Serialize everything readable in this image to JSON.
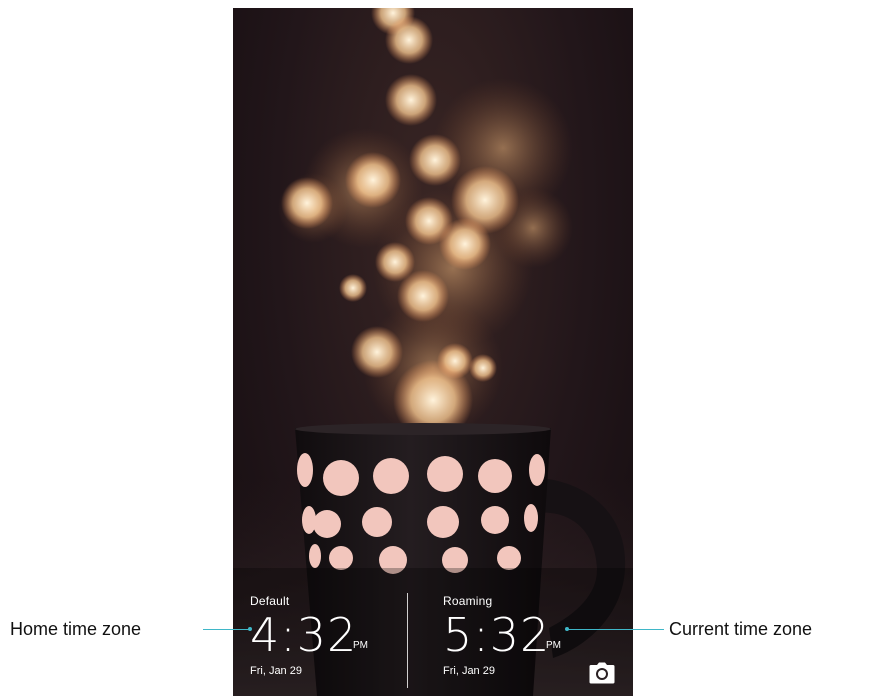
{
  "lockscreen": {
    "home": {
      "label": "Default",
      "time": "4:32",
      "ampm": "PM",
      "date": "Fri, Jan 29"
    },
    "current": {
      "label": "Roaming",
      "time": "5:32",
      "ampm": "PM",
      "date": "Fri, Jan 29"
    },
    "camera_icon": "camera-icon"
  },
  "callouts": {
    "home": "Home time zone",
    "current": "Current time zone"
  },
  "colors": {
    "callout_line": "#3fb7c8",
    "mug": "#1a1518",
    "dots": "#f2c6bd",
    "bokeh": "#ffd9a8"
  }
}
